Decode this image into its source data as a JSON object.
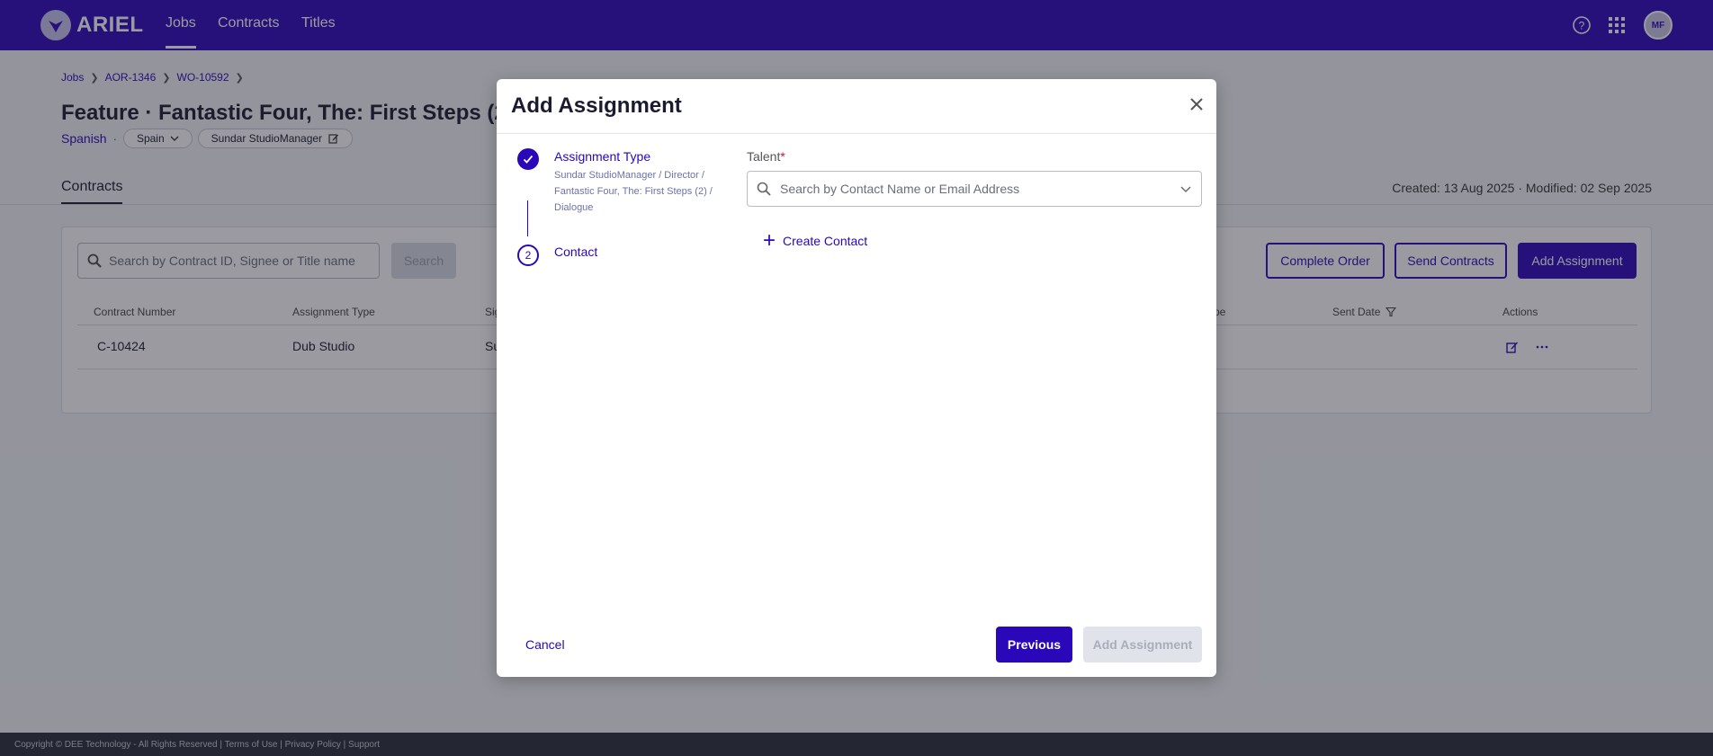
{
  "nav": {
    "brand": "ARIEL",
    "links": [
      "Jobs",
      "Contracts",
      "Titles"
    ],
    "active": "Jobs",
    "avatar_initials": "MF",
    "brand_color": "#2a07b8"
  },
  "breadcrumb": [
    "Jobs",
    "AOR-1346",
    "WO-10592"
  ],
  "page": {
    "title": "Feature · Fantastic Four, The: First Steps (20",
    "language": "Spanish",
    "region_pill": "Spain",
    "manager_pill": "Sundar StudioManager",
    "tab": "Contracts",
    "meta": "Created: 13 Aug 2025 · Modified: 02 Sep 2025"
  },
  "toolbar": {
    "search_placeholder": "Search by Contract ID, Signee or Title name",
    "search_button": "Search",
    "complete_order": "Complete Order",
    "send_contracts": "Send Contracts",
    "add_assignment": "Add Assignment"
  },
  "table": {
    "columns": [
      "Contract Number",
      "Assignment Type",
      "Sig",
      "pe",
      "Sent Date",
      "Actions"
    ],
    "rows": [
      {
        "contract_number": "C-10424",
        "assignment_type": "Dub Studio",
        "signee_partial": "Su"
      }
    ]
  },
  "modal": {
    "title": "Add Assignment",
    "steps": [
      {
        "title": "Assignment Type",
        "detail": "Sundar StudioManager / Director / Fantastic Four, The: First Steps (2) / Dialogue",
        "state": "complete"
      },
      {
        "number": "2",
        "title": "Contact",
        "state": "current"
      }
    ],
    "talent_label": "Talent",
    "required_mark": "*",
    "talent_placeholder": "Search by Contact Name or Email Address",
    "create_contact": "Create Contact",
    "cancel": "Cancel",
    "previous": "Previous",
    "submit": "Add Assignment"
  },
  "footer": "Copyright © DEE Technology - All Rights Reserved | Terms of Use | Privacy Policy | Support"
}
